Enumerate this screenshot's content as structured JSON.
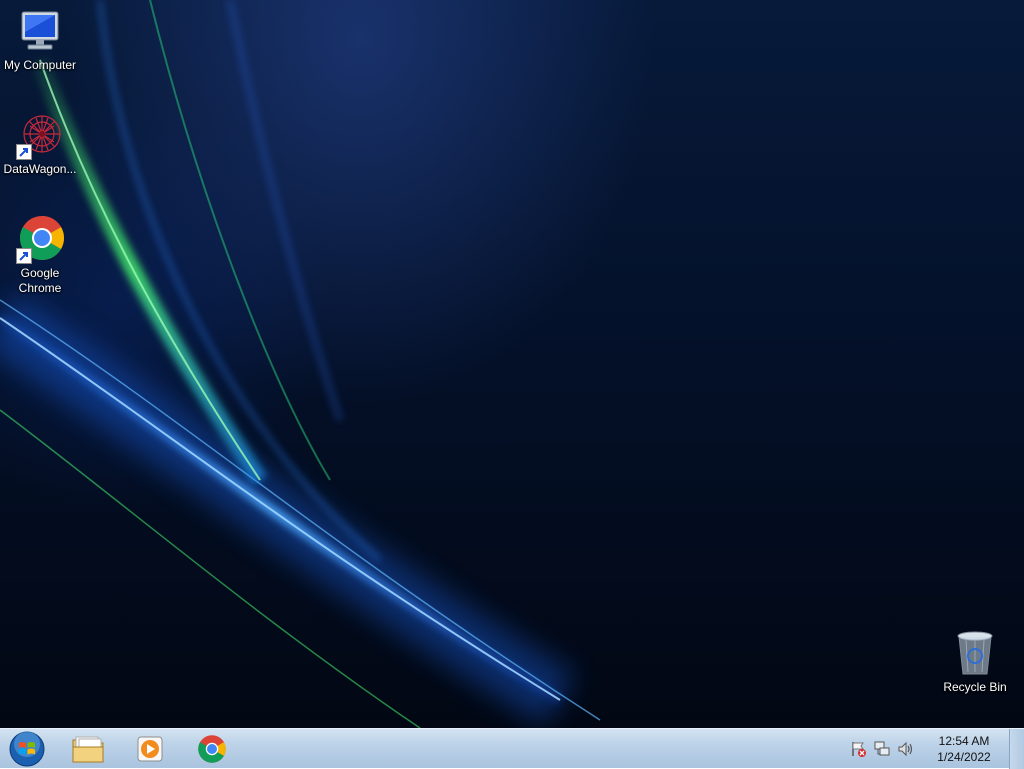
{
  "desktop": {
    "icons": [
      {
        "label": "My Computer",
        "icon": "computer-icon"
      },
      {
        "label": "DataWagon...",
        "icon": "datawagon-icon"
      },
      {
        "label": "Google Chrome",
        "icon": "chrome-icon"
      },
      {
        "label": "Recycle Bin",
        "icon": "recycle-bin-icon"
      }
    ]
  },
  "taskbar": {
    "pinned": [
      {
        "name": "Windows Explorer",
        "icon": "folder-icon"
      },
      {
        "name": "Windows Media Player",
        "icon": "media-player-icon"
      },
      {
        "name": "Google Chrome",
        "icon": "chrome-icon"
      }
    ],
    "tray": {
      "icons": [
        "action-center-icon",
        "network-icon",
        "volume-icon"
      ],
      "time": "12:54 AM",
      "date": "1/24/2022"
    }
  },
  "colors": {
    "taskbar": "#bcd2e8",
    "wallpaper_dark": "#020713",
    "wallpaper_glow": "#2a7bff",
    "wallpaper_green": "#3ddc6a"
  }
}
